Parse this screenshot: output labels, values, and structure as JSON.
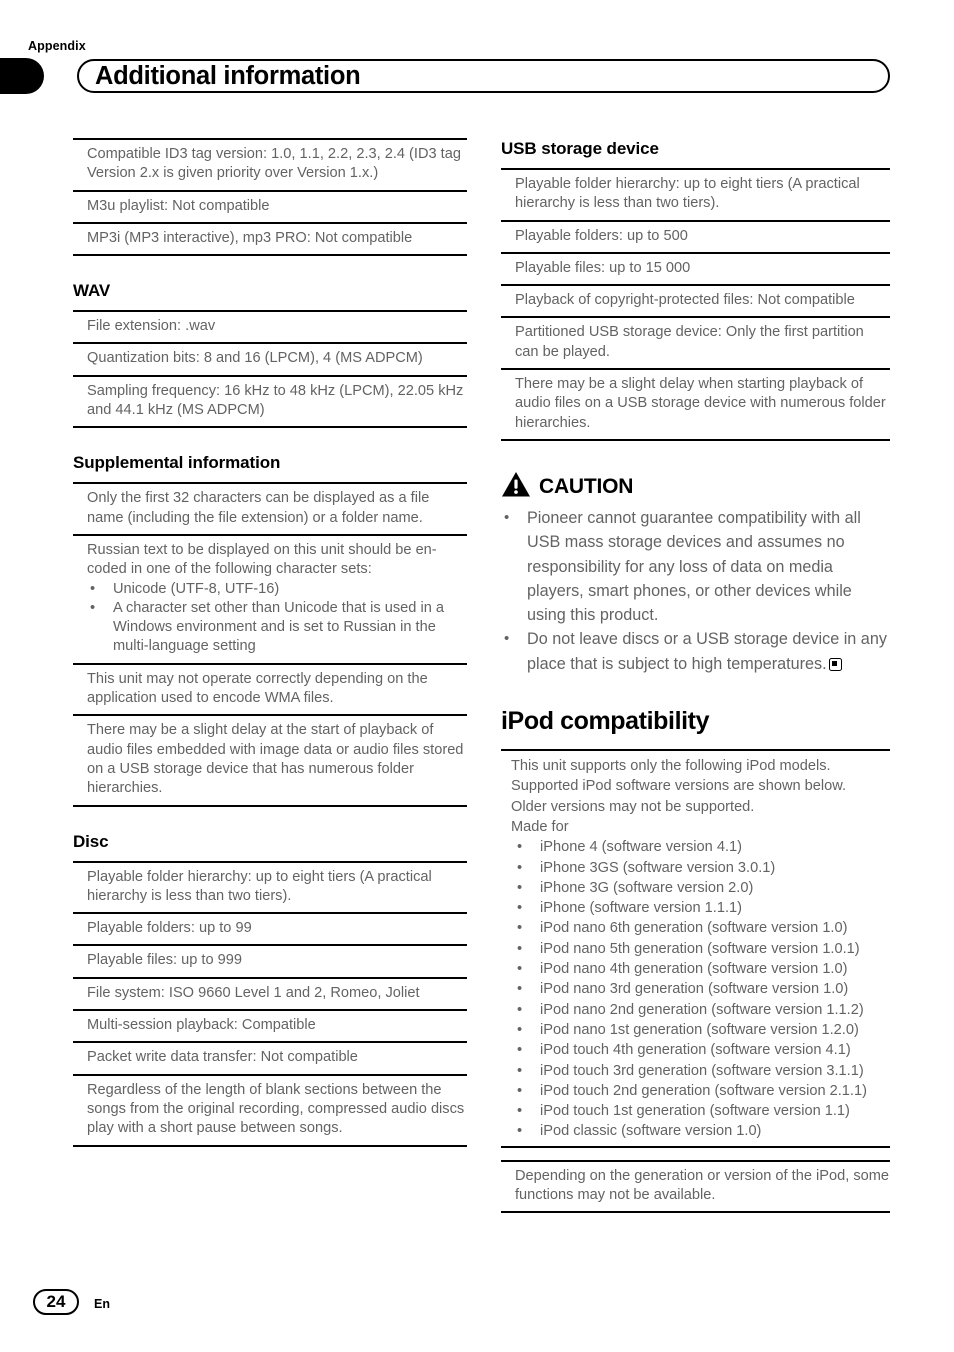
{
  "header": {
    "appendix_label": "Appendix",
    "title": "Additional information"
  },
  "footer": {
    "page_number": "24",
    "language": "En"
  },
  "left_column": {
    "id3_table": {
      "rows": [
        "Compatible ID3 tag version: 1.0, 1.1, 2.2, 2.3, 2.4 (ID3 tag Version 2.x is given priority over Version 1.x.)",
        "M3u playlist: Not compatible",
        "MP3i (MP3 interactive), mp3 PRO: Not compatible"
      ]
    },
    "wav": {
      "heading": "WAV",
      "rows": [
        "File extension: .wav",
        "Quantization bits: 8 and 16 (LPCM), 4 (MS ADPCM)",
        "Sampling frequency: 16 kHz to 48 kHz (LPCM), 22.05 kHz and 44.1 kHz (MS ADPCM)"
      ]
    },
    "supplemental": {
      "heading": "Supplemental information",
      "row1": "Only the first 32 characters can be displayed as a file name (including the file extension) or a folder name.",
      "row2_intro": "Russian text to be displayed on this unit should be en-coded in one of the following character sets:",
      "row2_bullets": [
        "Unicode (UTF-8, UTF-16)",
        "A character set other than Unicode that is used in a Windows environment and is set to Russian in the multi-language setting"
      ],
      "row3": "This unit may not operate correctly depending on the application used to encode WMA files.",
      "row4": "There may be a slight delay at the start of playback of audio files embedded with image data or audio files stored on a USB storage device that has numerous folder hierarchies."
    },
    "disc": {
      "heading": "Disc",
      "rows": [
        "Playable folder hierarchy: up to eight tiers (A practical hierarchy is less than two tiers).",
        "Playable folders: up to 99",
        "Playable files: up to 999",
        "File system: ISO 9660 Level 1 and 2, Romeo, Joliet",
        "Multi-session playback: Compatible",
        "Packet write data transfer: Not compatible",
        "Regardless of the length of blank sections between the songs from the original recording, compressed audio discs play with a short pause between songs."
      ]
    }
  },
  "right_column": {
    "usb": {
      "heading": "USB storage device",
      "rows": [
        "Playable folder hierarchy: up to eight tiers (A practical hierarchy is less than two tiers).",
        "Playable folders: up to 500",
        "Playable files: up to 15 000",
        "Playback of copyright-protected files: Not compatible",
        "Partitioned USB storage device: Only the first partition can be played.",
        "There may be a slight delay when starting playback of audio files on a USB storage device with numerous folder hierarchies."
      ]
    },
    "caution": {
      "heading": "CAUTION",
      "icon": "warning-triangle-icon",
      "bullets": [
        "Pioneer cannot guarantee compatibility with all USB mass storage devices and assumes no responsibility for any loss of data on media players, smart phones, or other devices while using this product.",
        "Do not leave discs or a USB storage device in any place that is subject to high temperatures."
      ],
      "end_marker": "end-of-section-marker"
    },
    "ipod": {
      "heading": "iPod compatibility",
      "intro_lines": [
        "This unit supports only the following iPod models.",
        "Supported iPod software versions are shown below.",
        "Older versions may not be supported.",
        "Made for"
      ],
      "models": [
        "iPhone 4 (software version 4.1)",
        "iPhone 3GS (software version 3.0.1)",
        "iPhone 3G (software version 2.0)",
        "iPhone (software version 1.1.1)",
        "iPod nano 6th generation (software version 1.0)",
        "iPod nano 5th generation (software version 1.0.1)",
        "iPod nano 4th generation (software version 1.0)",
        "iPod nano 3rd generation (software version 1.0)",
        "iPod nano 2nd generation (software version 1.1.2)",
        "iPod nano 1st generation (software version 1.2.0)",
        "iPod touch 4th generation (software version 4.1)",
        "iPod touch 3rd generation (software version 3.1.1)",
        "iPod touch 2nd generation (software version 2.1.1)",
        "iPod touch 1st generation (software version 1.1)",
        "iPod classic (software version 1.0)"
      ],
      "note": "Depending on the generation or version of the iPod, some functions may not be available."
    }
  },
  "symbols": {
    "bullet": "•"
  }
}
